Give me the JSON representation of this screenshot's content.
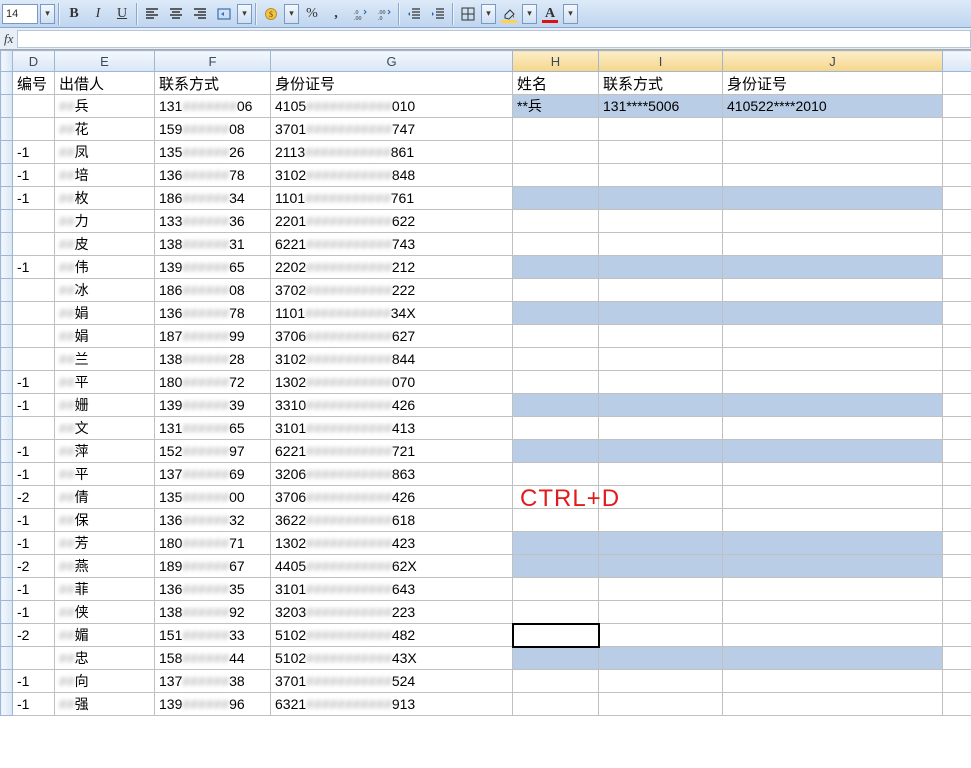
{
  "toolbar": {
    "font_size": "14",
    "bold": "B",
    "italic": "I",
    "underline": "U",
    "percent": "%",
    "comma": ",",
    "inc_dec_dec": ".0",
    "font_color_letter": "A",
    "fill_color_letter": ""
  },
  "formula_bar": {
    "fx": "fx"
  },
  "columns": {
    "D": "D",
    "E": "E",
    "F": "F",
    "G": "G",
    "H": "H",
    "I": "I",
    "J": "J"
  },
  "headers": {
    "D": "编号",
    "E": "出借人",
    "F": "联系方式",
    "G": "身份证号",
    "H": "姓名",
    "I": "联系方式",
    "J": "身份证号"
  },
  "result_row": {
    "H": "**兵",
    "I": "131****5006",
    "J": "410522****2010"
  },
  "overlay": "CTRL+D",
  "rows": [
    {
      "d": "",
      "eSuffix": "兵",
      "fPre": "131",
      "fSuf": "06",
      "gPre": "4105",
      "gSuf": "010"
    },
    {
      "d": "",
      "eSuffix": "花",
      "fPre": "159",
      "fSuf": "08",
      "gPre": "3701",
      "gSuf": "747"
    },
    {
      "d": "-1",
      "eSuffix": "凤",
      "fPre": "135",
      "fSuf": "26",
      "gPre": "2113",
      "gSuf": "861"
    },
    {
      "d": "-1",
      "eSuffix": "培",
      "fPre": "136",
      "fSuf": "78",
      "gPre": "3102",
      "gSuf": "848"
    },
    {
      "d": "-1",
      "eSuffix": "枚",
      "fPre": "186",
      "fSuf": "34",
      "gPre": "1101",
      "gSuf": "761",
      "hl": true
    },
    {
      "d": "",
      "eSuffix": "力",
      "fPre": "133",
      "fSuf": "36",
      "gPre": "2201",
      "gSuf": "622"
    },
    {
      "d": "",
      "eSuffix": "皮",
      "fPre": "138",
      "fSuf": "31",
      "gPre": "6221",
      "gSuf": "743"
    },
    {
      "d": "-1",
      "eSuffix": "伟",
      "fPre": "139",
      "fSuf": "65",
      "gPre": "2202",
      "gSuf": "212",
      "hl": true
    },
    {
      "d": "",
      "eSuffix": "冰",
      "fPre": "186",
      "fSuf": "08",
      "gPre": "3702",
      "gSuf": "222"
    },
    {
      "d": "",
      "eSuffix": "娟",
      "fPre": "136",
      "fSuf": "78",
      "gPre": "1101",
      "gSuf": "34X",
      "hl": true
    },
    {
      "d": "",
      "eSuffix": "娟",
      "fPre": "187",
      "fSuf": "99",
      "gPre": "3706",
      "gSuf": "627"
    },
    {
      "d": "",
      "eSuffix": "兰",
      "fPre": "138",
      "fSuf": "28",
      "gPre": "3102",
      "gSuf": "844"
    },
    {
      "d": "-1",
      "eSuffix": "平",
      "fPre": "180",
      "fSuf": "72",
      "gPre": "1302",
      "gSuf": "070"
    },
    {
      "d": "-1",
      "eSuffix": "姗",
      "fPre": "139",
      "fSuf": "39",
      "gPre": "3310",
      "gSuf": "426",
      "hl": true
    },
    {
      "d": "",
      "eSuffix": "文",
      "fPre": "131",
      "fSuf": "65",
      "gPre": "3101",
      "gSuf": "413"
    },
    {
      "d": "-1",
      "eSuffix": "萍",
      "fPre": "152",
      "fSuf": "97",
      "gPre": "6221",
      "gSuf": "721",
      "hl": true
    },
    {
      "d": "-1",
      "eSuffix": "平",
      "fPre": "137",
      "fSuf": "69",
      "gPre": "3206",
      "gSuf": "863"
    },
    {
      "d": "-2",
      "eSuffix": "倩",
      "fPre": "135",
      "fSuf": "00",
      "gPre": "3706",
      "gSuf": "426"
    },
    {
      "d": "-1",
      "eSuffix": "保",
      "fPre": "136",
      "fSuf": "32",
      "gPre": "3622",
      "gSuf": "618"
    },
    {
      "d": "-1",
      "eSuffix": "芳",
      "fPre": "180",
      "fSuf": "71",
      "gPre": "1302",
      "gSuf": "423",
      "hl": true
    },
    {
      "d": "-2",
      "eSuffix": "燕",
      "fPre": "189",
      "fSuf": "67",
      "gPre": "4405",
      "gSuf": "62X",
      "hl": true
    },
    {
      "d": "-1",
      "eSuffix": "菲",
      "fPre": "136",
      "fSuf": "35",
      "gPre": "3101",
      "gSuf": "643"
    },
    {
      "d": "-1",
      "eSuffix": "侠",
      "fPre": "138",
      "fSuf": "92",
      "gPre": "3203",
      "gSuf": "223"
    },
    {
      "d": "-2",
      "eSuffix": "媚",
      "fPre": "151",
      "fSuf": "33",
      "gPre": "5102",
      "gSuf": "482",
      "active": true
    },
    {
      "d": "",
      "eSuffix": "忠",
      "fPre": "158",
      "fSuf": "44",
      "gPre": "5102",
      "gSuf": "43X",
      "hl": true
    },
    {
      "d": "-1",
      "eSuffix": "向",
      "fPre": "137",
      "fSuf": "38",
      "gPre": "3701",
      "gSuf": "524"
    },
    {
      "d": "-1",
      "eSuffix": "强",
      "fPre": "139",
      "fSuf": "96",
      "gPre": "6321",
      "gSuf": "913"
    }
  ]
}
